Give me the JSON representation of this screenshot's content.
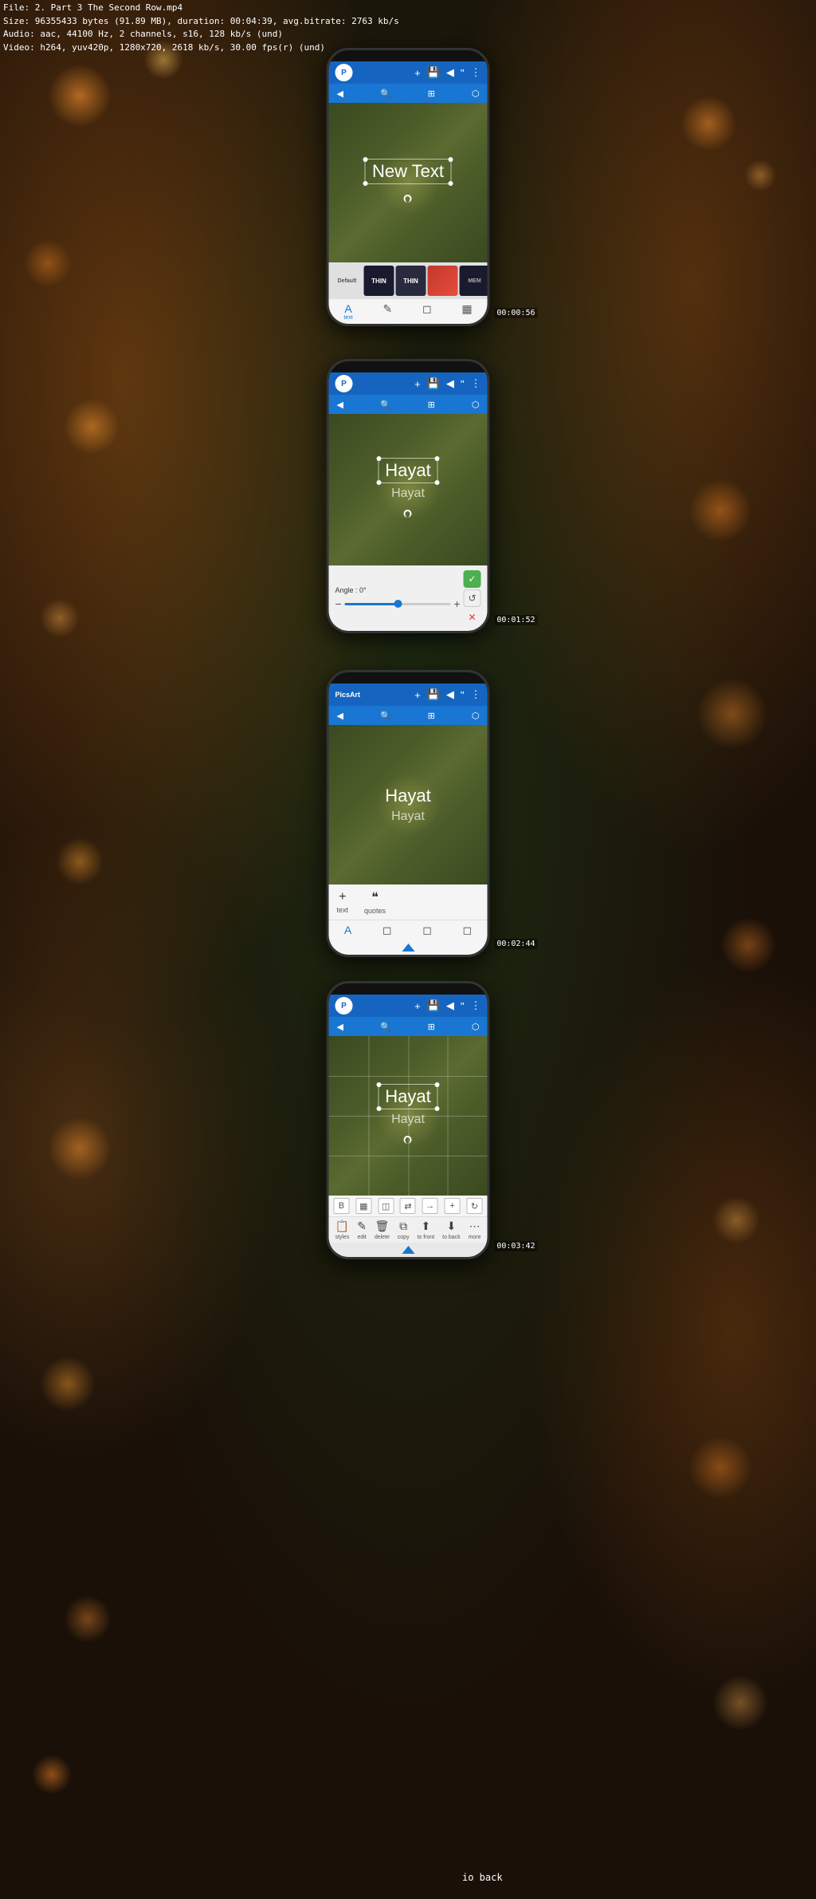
{
  "file_info": {
    "line1": "File: 2. Part 3 The Second Row.mp4",
    "line2": "Size: 96355433 bytes (91.89 MB), duration: 00:04:39, avg.bitrate: 2763 kb/s",
    "line3": "Audio: aac, 44100 Hz, 2 channels, s16, 128 kb/s (und)",
    "line4": "Video: h264, yuv420p, 1280x720, 2618 kb/s, 30.00 fps(r) (und)"
  },
  "section1": {
    "timestamp": "00:00:56",
    "canvas_text_primary": "New Text",
    "template_items": [
      "Default",
      "THIN",
      "THIN",
      "",
      "MEM"
    ],
    "toolbar": {
      "icons": [
        "+",
        "💾",
        "◀",
        "\"",
        "⋮"
      ],
      "sub_icons": [
        "◀",
        "🔍",
        "⊞",
        "⬡"
      ]
    }
  },
  "section2": {
    "timestamp": "00:01:52",
    "canvas_text_primary": "Hayat",
    "canvas_text_secondary": "Hayat",
    "slider_label": "Angle : 0°",
    "slider_value": 50,
    "action_check": "✓",
    "action_undo": "↺",
    "action_close": "✕"
  },
  "section3": {
    "timestamp": "00:02:44",
    "canvas_text_primary": "Hayat",
    "canvas_text_secondary": "Hayat",
    "brand": "PicsArt",
    "panel_items": [
      {
        "icon": "+",
        "label": "text"
      },
      {
        "icon": "❝",
        "label": "quotes"
      }
    ]
  },
  "section4": {
    "timestamp": "00:03:42",
    "canvas_text_primary": "Hayat",
    "canvas_text_secondary": "Hayat",
    "edit_tools": [
      "B",
      "▦",
      "◫",
      "⇄",
      "→",
      "+",
      "↻"
    ],
    "bottom_actions": [
      {
        "icon": "📋",
        "label": "styles"
      },
      {
        "icon": "✎",
        "label": "edit"
      },
      {
        "icon": "🗑",
        "label": "delete"
      },
      {
        "icon": "⧉",
        "label": "copy"
      },
      {
        "icon": "⬆",
        "label": "to front"
      },
      {
        "icon": "⬇",
        "label": "to back"
      },
      {
        "icon": "⋯",
        "label": "more"
      }
    ]
  },
  "bottom_text": "io back"
}
